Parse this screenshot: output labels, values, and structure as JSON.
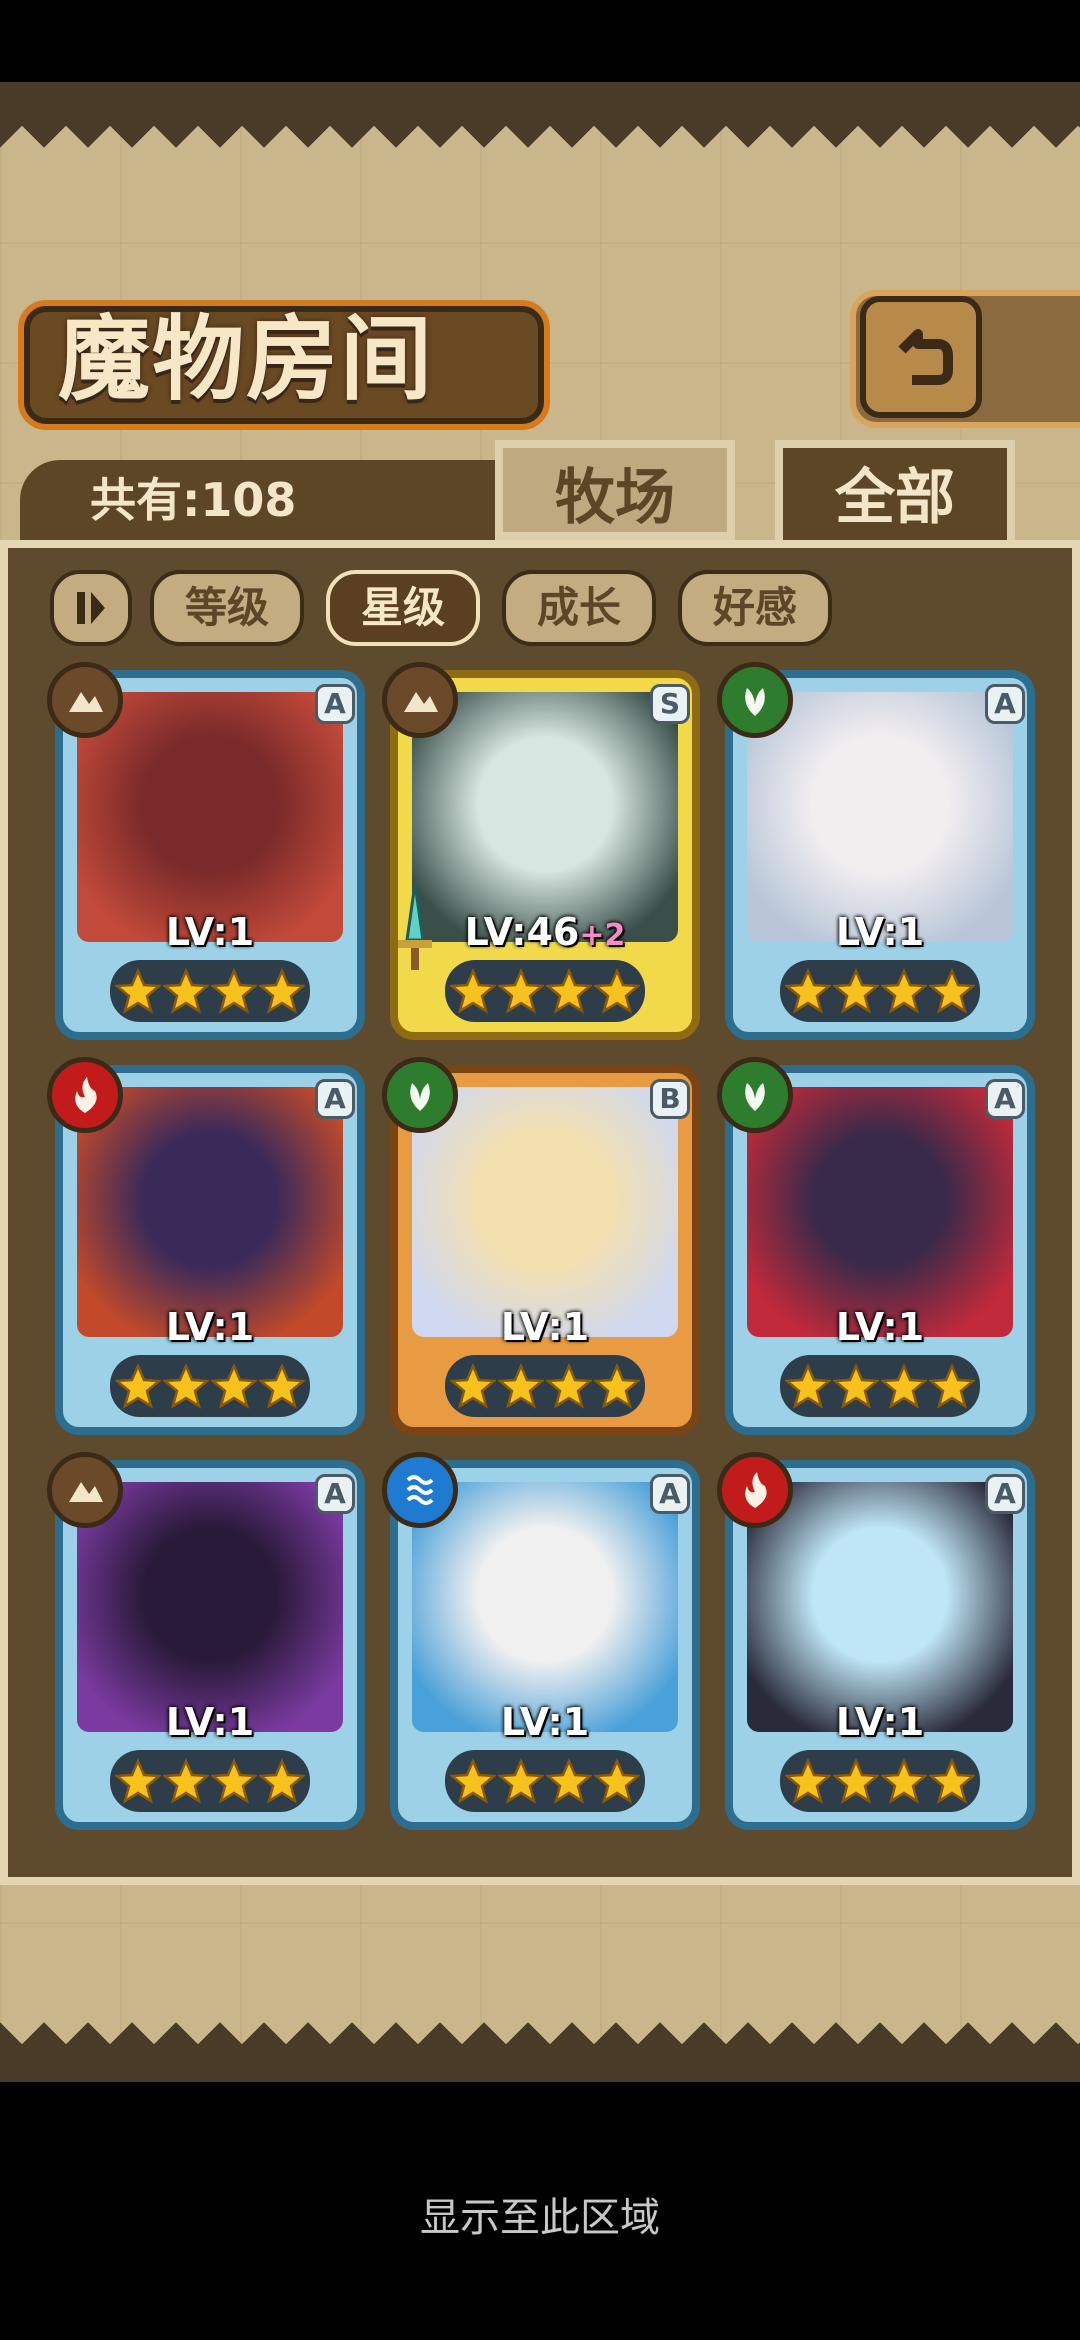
{
  "header": {
    "title": "魔物房间"
  },
  "summary": {
    "count_label": "共有:108"
  },
  "tabs": [
    {
      "label": "牧场",
      "active": false
    },
    {
      "label": "全部",
      "active": true
    }
  ],
  "filters": [
    {
      "label": "等级",
      "active": false
    },
    {
      "label": "星级",
      "active": true
    },
    {
      "label": "成长",
      "active": false
    },
    {
      "label": "好感",
      "active": false
    }
  ],
  "monsters": [
    {
      "level": "LV:1",
      "plus": "",
      "rank": "A",
      "element": "earth-icon",
      "stars": 4
    },
    {
      "level": "LV:46",
      "plus": "+2",
      "rank": "S",
      "element": "earth-icon",
      "stars": 4
    },
    {
      "level": "LV:1",
      "plus": "",
      "rank": "A",
      "element": "leaf-icon",
      "stars": 4
    },
    {
      "level": "LV:1",
      "plus": "",
      "rank": "A",
      "element": "fire-icon",
      "stars": 4
    },
    {
      "level": "LV:1",
      "plus": "",
      "rank": "B",
      "element": "leaf-icon",
      "stars": 4
    },
    {
      "level": "LV:1",
      "plus": "",
      "rank": "A",
      "element": "leaf-icon",
      "stars": 4
    },
    {
      "level": "LV:1",
      "plus": "",
      "rank": "A",
      "element": "earth-icon",
      "stars": 4
    },
    {
      "level": "LV:1",
      "plus": "",
      "rank": "A",
      "element": "water-icon",
      "stars": 4
    },
    {
      "level": "LV:1",
      "plus": "",
      "rank": "A",
      "element": "fire-icon",
      "stars": 4
    }
  ],
  "colors": {
    "earth": "#6b4a2a",
    "leaf": "#2e7d2e",
    "fire": "#c21b1b",
    "water": "#1f7bd1"
  },
  "footer": {
    "hint": "显示至此区域"
  }
}
